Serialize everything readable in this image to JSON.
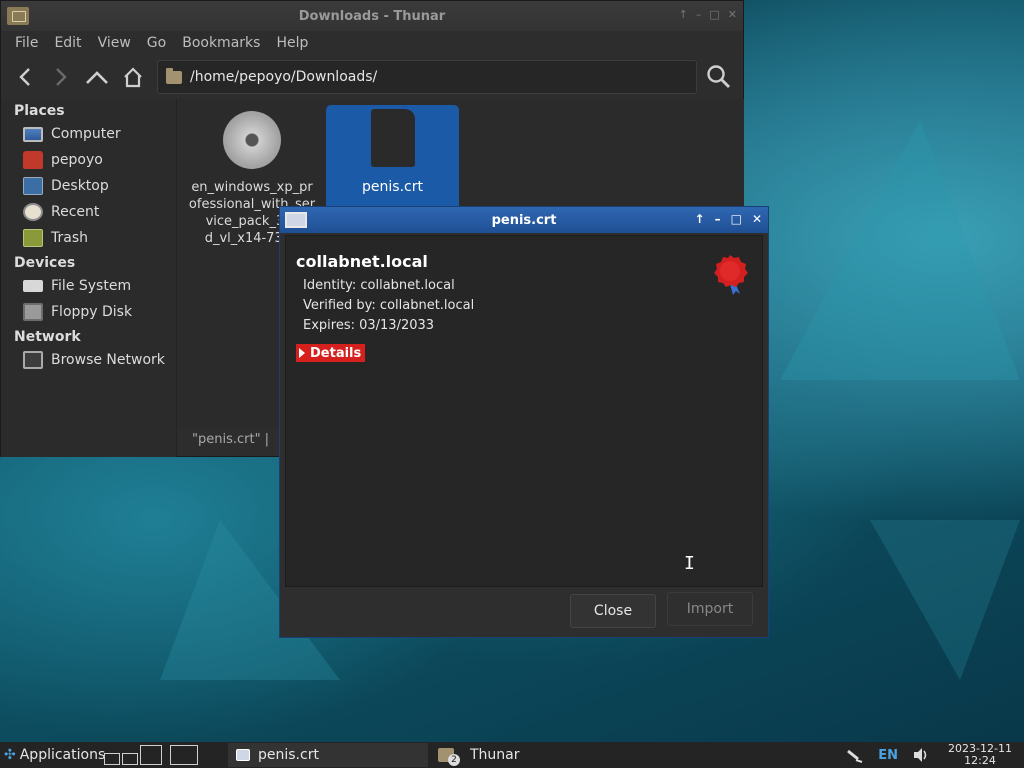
{
  "thunar": {
    "title": "Downloads - Thunar",
    "menu": [
      "File",
      "Edit",
      "View",
      "Go",
      "Bookmarks",
      "Help"
    ],
    "path": "/home/pepoyo/Downloads/",
    "sidebar": {
      "places_header": "Places",
      "places": [
        {
          "label": "Computer",
          "icon": "computer-icon"
        },
        {
          "label": "pepoyo",
          "icon": "home-icon"
        },
        {
          "label": "Desktop",
          "icon": "desktop-icon"
        },
        {
          "label": "Recent",
          "icon": "recent-icon"
        },
        {
          "label": "Trash",
          "icon": "trash-icon"
        }
      ],
      "devices_header": "Devices",
      "devices": [
        {
          "label": "File System",
          "icon": "filesystem-icon"
        },
        {
          "label": "Floppy Disk",
          "icon": "floppy-icon"
        }
      ],
      "network_header": "Network",
      "network": [
        {
          "label": "Browse Network",
          "icon": "network-icon"
        }
      ]
    },
    "files": [
      {
        "name": "en_windows_xp_pr\nofessional_with_ser\nvice_pack_3_x\nd_vl_x14-7397",
        "icon": "disc-icon"
      },
      {
        "name": "penis.crt",
        "icon": "document-icon",
        "selected": true
      }
    ],
    "status": "\"penis.crt\"  |"
  },
  "dialog": {
    "title": "penis.crt",
    "cert_name": "collabnet.local",
    "identity": "Identity: collabnet.local",
    "verified_by": "Verified by: collabnet.local",
    "expires": "Expires: 03/13/2033",
    "details_label": "Details",
    "close_label": "Close",
    "import_label": "Import"
  },
  "taskbar": {
    "applications_label": "Applications",
    "tasks": [
      {
        "label": "penis.crt",
        "active": true
      },
      {
        "label": "Thunar",
        "badge": "2"
      }
    ],
    "keyboard_layout": "EN",
    "clock_date": "2023-12-11",
    "clock_time": "12:24"
  }
}
